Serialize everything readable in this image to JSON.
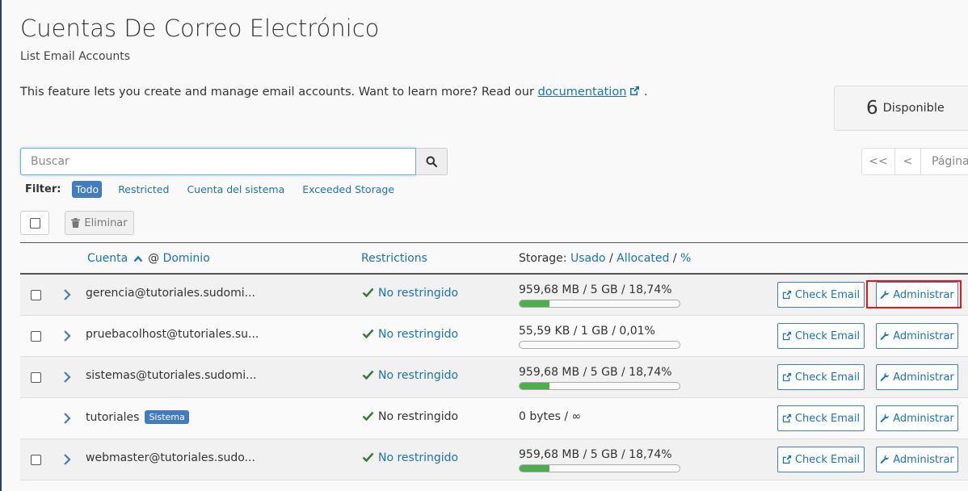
{
  "header": {
    "title": "Cuentas De Correo Electrónico",
    "subtitle": "List Email Accounts",
    "description": "This feature lets you create and manage email accounts. Want to learn more? Read our",
    "doc_link": "documentation",
    "description_end": "."
  },
  "available": {
    "count": "6",
    "label": "Disponible"
  },
  "search": {
    "placeholder": "Buscar",
    "value": ""
  },
  "pager": {
    "first": "<<",
    "prev": "<",
    "page_label": "Página"
  },
  "filter": {
    "label": "Filter:",
    "options": [
      "Todo",
      "Restricted",
      "Cuenta del sistema",
      "Exceeded Storage"
    ],
    "active": "Todo"
  },
  "toolbar": {
    "delete_label": "Eliminar"
  },
  "columns": {
    "account": "Cuenta",
    "at": "@",
    "domain": "Dominio",
    "restrictions": "Restrictions",
    "storage_prefix": "Storage:",
    "used": "Usado",
    "allocated": "Allocated",
    "percent": "%",
    "sep": "/"
  },
  "rows": [
    {
      "account": "gerencia@tutoriales.sudomi...",
      "restriction": "No restringido",
      "storage": "959,68 MB / 5 GB / 18,74%",
      "usage_pct": 18.74,
      "check": "Check Email",
      "manage": "Administrar"
    },
    {
      "account": "pruebacolhost@tutoriales.su...",
      "restriction": "No restringido",
      "storage": "55,59 KB / 1 GB / 0,01%",
      "usage_pct": 0.01,
      "check": "Check Email",
      "manage": "Administrar"
    },
    {
      "account": "sistemas@tutoriales.sudomi...",
      "restriction": "No restringido",
      "storage": "959,68 MB / 5 GB / 18,74%",
      "usage_pct": 18.74,
      "check": "Check Email",
      "manage": "Administrar"
    },
    {
      "account": "tutoriales",
      "badge": "Sistema",
      "restriction": "No restringido",
      "storage": "0 bytes / ∞",
      "check": "Check Email",
      "manage": "Administrar"
    },
    {
      "account": "webmaster@tutoriales.sudo...",
      "restriction": "No restringido",
      "storage": "959,68 MB / 5 GB / 18,74%",
      "usage_pct": 18.74,
      "check": "Check Email",
      "manage": "Administrar"
    }
  ],
  "colors": {
    "link": "#1a73b8",
    "accent": "#3f7cc1",
    "progress": "#4cae4c",
    "highlight": "#e3161a"
  }
}
